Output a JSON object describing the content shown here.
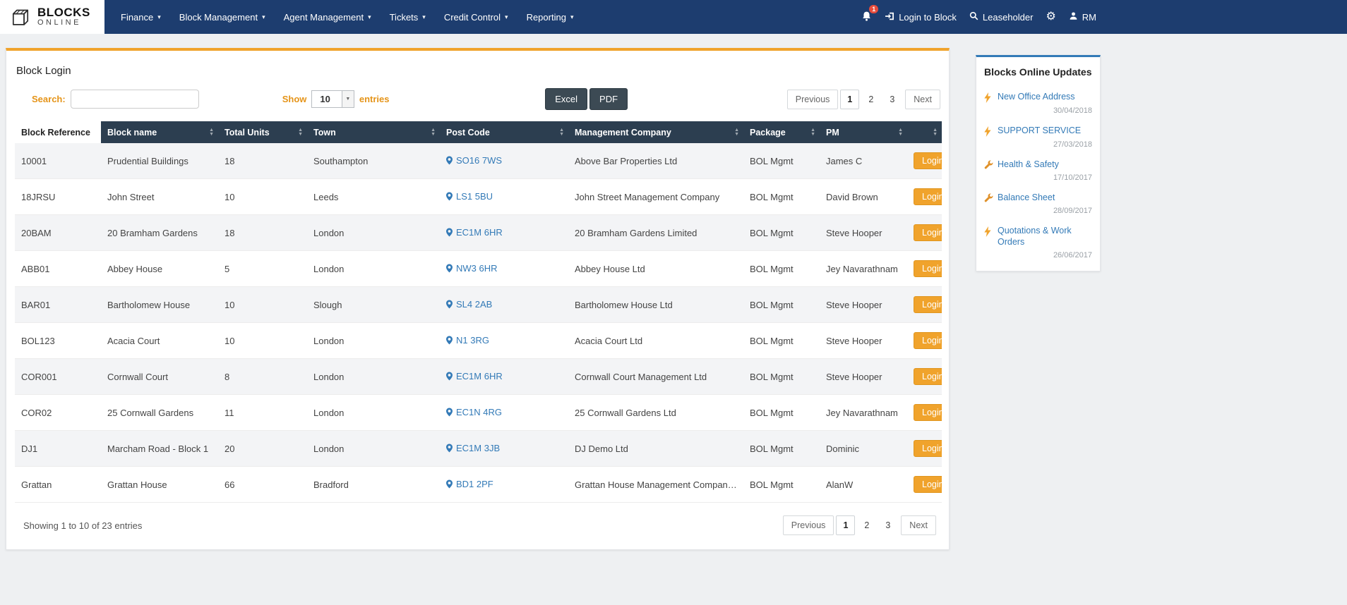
{
  "brand": {
    "line1": "BLOCKS",
    "line2": "ONLINE"
  },
  "nav": {
    "items": [
      {
        "label": "Finance"
      },
      {
        "label": "Block Management"
      },
      {
        "label": "Agent Management"
      },
      {
        "label": "Tickets"
      },
      {
        "label": "Credit Control"
      },
      {
        "label": "Reporting"
      }
    ],
    "notification_badge": "1",
    "login_to_block": "Login to Block",
    "leaseholder": "Leaseholder",
    "user_initials": "RM"
  },
  "page": {
    "title": "Block Login",
    "search_label": "Search:",
    "show_label": "Show",
    "entries_label": "entries",
    "page_length": "10",
    "excel_label": "Excel",
    "pdf_label": "PDF",
    "info": "Showing 1 to 10 of 23 entries",
    "pagination": {
      "previous": "Previous",
      "next": "Next",
      "pages": [
        {
          "label": "1",
          "active": "true"
        },
        {
          "label": "2",
          "active": "false"
        },
        {
          "label": "3",
          "active": "false"
        }
      ]
    }
  },
  "table": {
    "columns": [
      "Block Reference",
      "Block name",
      "Total Units",
      "Town",
      "Post Code",
      "Management Company",
      "Package",
      "PM"
    ],
    "login_label": "Login",
    "rows": [
      {
        "ref": "10001",
        "name": "Prudential Buildings",
        "units": "18",
        "town": "Southampton",
        "postcode": "SO16 7WS",
        "company": "Above Bar Properties Ltd",
        "package": "BOL Mgmt",
        "pm": "James C"
      },
      {
        "ref": "18JRSU",
        "name": "John Street",
        "units": "10",
        "town": "Leeds",
        "postcode": "LS1 5BU",
        "company": "John Street Management Company",
        "package": "BOL Mgmt",
        "pm": "David Brown"
      },
      {
        "ref": "20BAM",
        "name": "20 Bramham Gardens",
        "units": "18",
        "town": "London",
        "postcode": "EC1M 6HR",
        "company": "20 Bramham Gardens Limited",
        "package": "BOL Mgmt",
        "pm": "Steve Hooper"
      },
      {
        "ref": "ABB01",
        "name": "Abbey House",
        "units": "5",
        "town": "London",
        "postcode": "NW3 6HR",
        "company": "Abbey House Ltd",
        "package": "BOL Mgmt",
        "pm": "Jey Navarathnam"
      },
      {
        "ref": "BAR01",
        "name": "Bartholomew House",
        "units": "10",
        "town": "Slough",
        "postcode": "SL4 2AB",
        "company": "Bartholomew House Ltd",
        "package": "BOL Mgmt",
        "pm": "Steve Hooper"
      },
      {
        "ref": "BOL123",
        "name": "Acacia Court",
        "units": "10",
        "town": "London",
        "postcode": "N1 3RG",
        "company": "Acacia Court Ltd",
        "package": "BOL Mgmt",
        "pm": "Steve Hooper"
      },
      {
        "ref": "COR001",
        "name": "Cornwall Court",
        "units": "8",
        "town": "London",
        "postcode": "EC1M 6HR",
        "company": "Cornwall Court Management Ltd",
        "package": "BOL Mgmt",
        "pm": "Steve Hooper"
      },
      {
        "ref": "COR02",
        "name": "25 Cornwall Gardens",
        "units": "11",
        "town": "London",
        "postcode": "EC1N 4RG",
        "company": "25 Cornwall Gardens Ltd",
        "package": "BOL Mgmt",
        "pm": "Jey Navarathnam"
      },
      {
        "ref": "DJ1",
        "name": "Marcham Road - Block 1",
        "units": "20",
        "town": "London",
        "postcode": "EC1M 3JB",
        "company": "DJ Demo Ltd",
        "package": "BOL Mgmt",
        "pm": "Dominic"
      },
      {
        "ref": "Grattan",
        "name": "Grattan House",
        "units": "66",
        "town": "Bradford",
        "postcode": "BD1 2PF",
        "company": "Grattan House Management Company Ltd",
        "package": "BOL Mgmt",
        "pm": "AlanW"
      }
    ]
  },
  "updates": {
    "title": "Blocks Online Updates",
    "items": [
      {
        "label": "New Office Address",
        "date": "30/04/2018",
        "icon": "lightning-icon"
      },
      {
        "label": "SUPPORT SERVICE",
        "date": "27/03/2018",
        "icon": "lightning-icon"
      },
      {
        "label": "Health & Safety",
        "date": "17/10/2017",
        "icon": "wrench-icon"
      },
      {
        "label": "Balance Sheet",
        "date": "28/09/2017",
        "icon": "wrench-icon"
      },
      {
        "label": "Quotations & Work Orders",
        "date": "26/06/2017",
        "icon": "lightning-icon"
      }
    ]
  },
  "colors": {
    "navbar_blue": "#1d3d6f",
    "accent_orange": "#f0a32c",
    "table_header_navy": "#2c3e50",
    "link_blue": "#337ab7",
    "badge_red": "#e74c3c"
  }
}
